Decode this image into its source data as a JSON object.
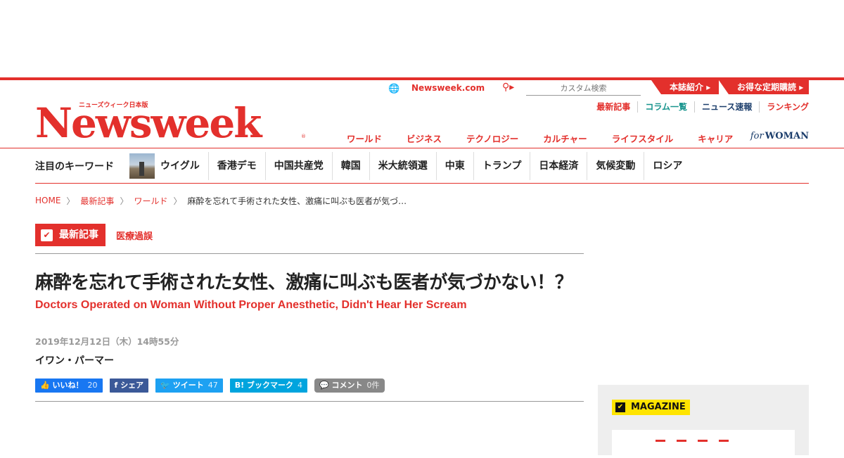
{
  "header": {
    "logo_sub": "ニューズウィーク日本版",
    "logo_main": "Newsweek",
    "logo_reg": "®",
    "site_link": "Newsweek.com",
    "search_placeholder": "カスタム検索",
    "btn_about": "本誌紹介",
    "btn_subscribe": "お得な定期購読",
    "sublinks": {
      "latest": "最新記事",
      "columns": "コラム一覧",
      "breaking": "ニュース速報",
      "ranking": "ランキング"
    },
    "nav": [
      "ワールド",
      "ビジネス",
      "テクノロジー",
      "カルチャー",
      "ライフスタイル",
      "キャリア"
    ],
    "for_woman_for": "for",
    "for_woman_woman": "WOMAN"
  },
  "keywords": {
    "title": "注目のキーワード",
    "items": [
      "ウイグル",
      "香港デモ",
      "中国共産党",
      "韓国",
      "米大統領選",
      "中東",
      "トランプ",
      "日本経済",
      "気候変動",
      "ロシア"
    ]
  },
  "breadcrumb": {
    "home": "HOME",
    "latest": "最新記事",
    "world": "ワールド",
    "current": "麻酔を忘れて手術された女性、激痛に叫ぶも医者が気づ…"
  },
  "article": {
    "category": "最新記事",
    "tag": "医療過誤",
    "title": "麻酔を忘れて手術された女性、激痛に叫ぶも医者が気づかない！？",
    "subtitle": "Doctors Operated on Woman Without Proper Anesthetic, Didn't Hear Her Scream",
    "date": "2019年12月12日（木）14時55分",
    "author": "イワン・パーマー"
  },
  "share": {
    "like_label": "いいね！",
    "like_count": "20",
    "fb_label": "シェア",
    "tweet_label": "ツイート",
    "tweet_count": "47",
    "hatena_label": "ブックマーク",
    "hatena_count": "4",
    "comment_label": "コメント",
    "comment_count": "0件"
  },
  "sidebar": {
    "magazine_label": "MAGAZINE"
  },
  "colors": {
    "brand_red": "#e3302c",
    "teal": "#17948d",
    "navy": "#1b3d6b",
    "magazine_yellow": "#ffe400"
  },
  "icons": [
    "globe-icon",
    "search-icon",
    "chevron-right-icon",
    "check-icon",
    "thumbs-up-icon",
    "facebook-icon",
    "twitter-icon",
    "hatena-icon",
    "comment-icon"
  ]
}
